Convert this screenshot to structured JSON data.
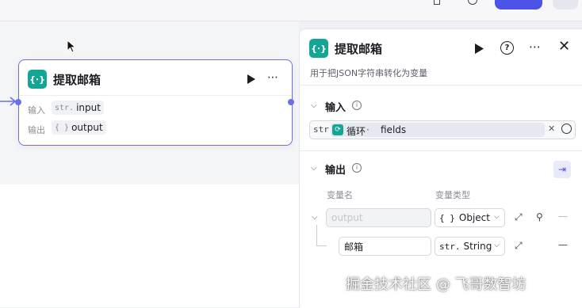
{
  "node": {
    "title": "提取邮箱",
    "icon": "braces-icon",
    "rows": [
      {
        "label": "输入",
        "type": "str.",
        "name": "input"
      },
      {
        "label": "输出",
        "type": "{ }",
        "name": "output"
      }
    ]
  },
  "panel": {
    "title": "提取邮箱",
    "description": "用于把JSON字符串转化为变量",
    "input_section": {
      "title": "输入",
      "value_type": "str.",
      "ref_source": "循环",
      "ref_sep": " · ",
      "ref_field": "fields"
    },
    "output_section": {
      "title": "输出",
      "col_name": "变量名",
      "col_type": "变量类型",
      "rows": [
        {
          "name_placeholder": "output",
          "name": "",
          "type_prefix": "{ }",
          "type": "Object"
        },
        {
          "name": "邮箱",
          "type_prefix": "str.",
          "type": "String"
        }
      ]
    }
  },
  "watermark": "掘金技术社区 @ 飞哥数智坊",
  "colors": {
    "accent": "#4d53e8",
    "node_icon": "#15a595",
    "node_border": "#6b70ea"
  }
}
